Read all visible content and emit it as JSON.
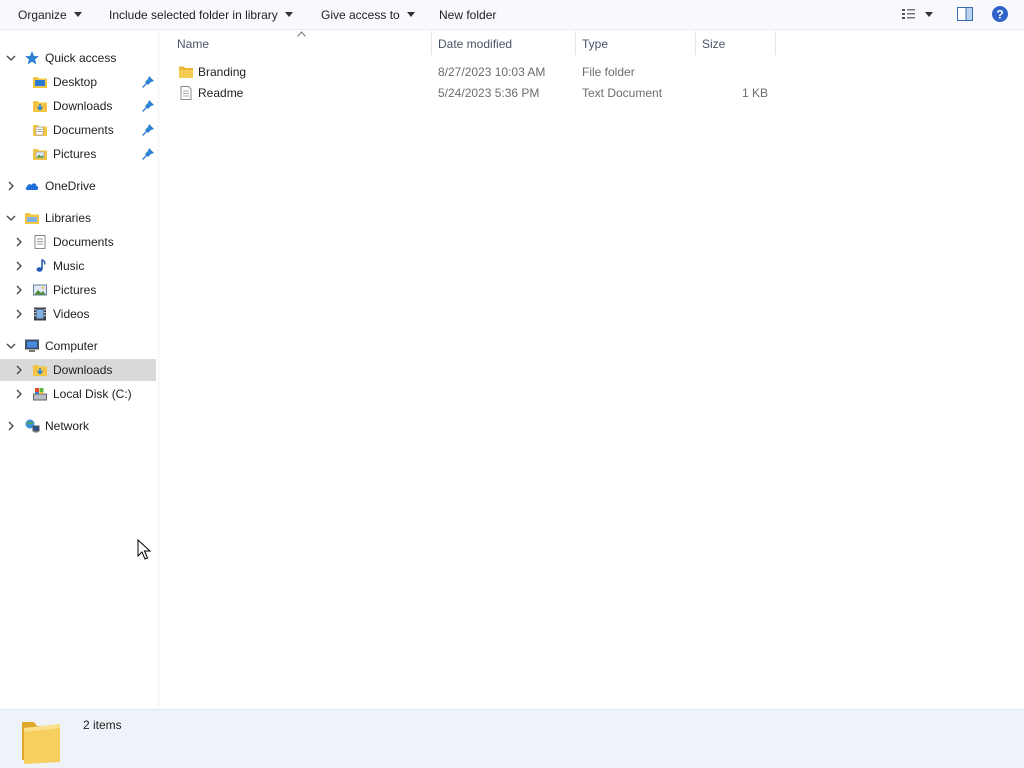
{
  "toolbar": {
    "organize": "Organize",
    "include_library": "Include selected folder in library",
    "give_access": "Give access to",
    "new_folder": "New folder"
  },
  "nav": {
    "quick_access": {
      "label": "Quick access",
      "items": [
        {
          "label": "Desktop",
          "icon": "desktop-icon"
        },
        {
          "label": "Downloads",
          "icon": "downloads-folder-icon"
        },
        {
          "label": "Documents",
          "icon": "documents-folder-icon"
        },
        {
          "label": "Pictures",
          "icon": "pictures-folder-icon"
        }
      ]
    },
    "onedrive": {
      "label": "OneDrive"
    },
    "libraries": {
      "label": "Libraries",
      "items": [
        {
          "label": "Documents"
        },
        {
          "label": "Music"
        },
        {
          "label": "Pictures"
        },
        {
          "label": "Videos"
        }
      ]
    },
    "computer": {
      "label": "Computer",
      "items": [
        {
          "label": "Downloads",
          "selected": true
        },
        {
          "label": "Local Disk (C:)"
        }
      ]
    },
    "network": {
      "label": "Network"
    }
  },
  "columns": {
    "name": "Name",
    "date_modified": "Date modified",
    "type": "Type",
    "size": "Size"
  },
  "files": [
    {
      "name": "Branding",
      "date": "8/27/2023 10:03 AM",
      "type": "File folder",
      "size": "",
      "icon": "folder-icon"
    },
    {
      "name": "Readme",
      "date": "5/24/2023 5:36 PM",
      "type": "Text Document",
      "size": "1 KB",
      "icon": "text-file-icon"
    }
  ],
  "status": {
    "count": "2 items"
  },
  "colors": {
    "selected_row": "#d9d9d9",
    "details_pane": "#eef3fa",
    "folder_yellow": "#f4c542",
    "accent_blue": "#1e6fd9"
  }
}
